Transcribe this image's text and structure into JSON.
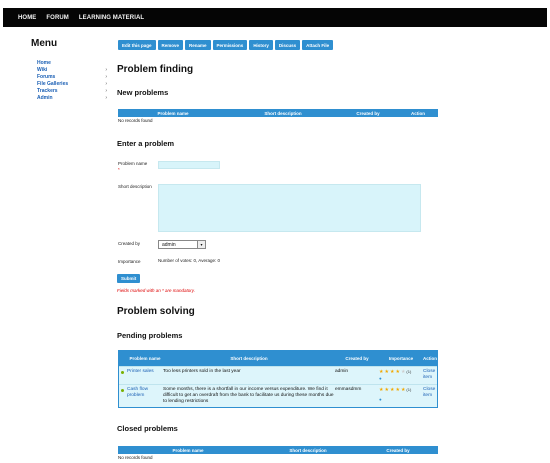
{
  "nav": [
    "HOME",
    "FORUM",
    "LEARNING MATERIAL"
  ],
  "menu": {
    "title": "Menu",
    "items": [
      {
        "label": "Home",
        "has_submenu": false
      },
      {
        "label": "Wiki",
        "has_submenu": true
      },
      {
        "label": "Forums",
        "has_submenu": true
      },
      {
        "label": "File Galleries",
        "has_submenu": true
      },
      {
        "label": "Trackers",
        "has_submenu": true
      },
      {
        "label": "Admin",
        "has_submenu": true
      }
    ]
  },
  "toolbar": [
    "Edit this page",
    "Remove",
    "Rename",
    "Permissions",
    "History",
    "Discuss",
    "Attach File"
  ],
  "page_title": "Problem finding",
  "new_problems": {
    "heading": "New problems",
    "columns": [
      "Problem name",
      "Short description",
      "Created by",
      "Action"
    ],
    "empty": "No records found"
  },
  "enter": {
    "heading": "Enter a problem",
    "name_label": "Problem name",
    "required_mark": "*",
    "desc_label": "Short description",
    "created_label": "Created by",
    "created_value": "admin",
    "importance_label": "Importance",
    "importance_value": "Number of votes: 0, Average: 0",
    "submit": "Submit",
    "mandatory_note": "Fields marked with an * are mandatory."
  },
  "solving_title": "Problem solving",
  "pending": {
    "heading": "Pending problems",
    "columns": [
      "Problem name",
      "Short description",
      "Created by",
      "Importance",
      "Action"
    ],
    "rows": [
      {
        "name": "Printer sales",
        "desc": "Too less printers sold in the last year",
        "by": "admin",
        "stars": 4,
        "votes": "(1)",
        "action": "Close item"
      },
      {
        "name": "Cash flow problem",
        "desc": "Some months, there is a shortfall in our income versus expenditure. We find it difficult to get an overdraft from the bank to facilitate us during these months due to lending restrictions",
        "by": "emmasdmm",
        "stars": 5,
        "votes": "(1)",
        "action": "Close item"
      }
    ]
  },
  "closed": {
    "heading": "Closed problems",
    "columns": [
      "Problem name",
      "Short description",
      "Created by"
    ],
    "empty": "No records found"
  },
  "colors": {
    "accent": "#2f8fd0",
    "topbar": "#050505",
    "row_bg": "#ddf5fb",
    "link": "#1a5fb4"
  }
}
